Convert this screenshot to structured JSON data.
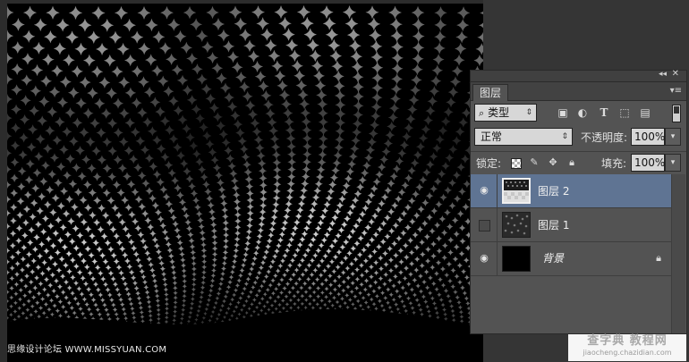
{
  "panel": {
    "tab_label": "图层",
    "filter": {
      "selected": "类型"
    },
    "filter_icons": [
      "image-icon",
      "adjustment-icon",
      "type-icon",
      "shape-icon",
      "smart-object-icon"
    ],
    "blend_mode": "正常",
    "opacity_label": "不透明度:",
    "opacity_value": "100%",
    "lock_label": "锁定:",
    "fill_label": "填充:",
    "fill_value": "100%",
    "layers": [
      {
        "name": "图层 2",
        "visible": true,
        "selected": true
      },
      {
        "name": "图层 1",
        "visible": false,
        "selected": false
      },
      {
        "name": "背景",
        "visible": true,
        "selected": false,
        "locked": true
      }
    ]
  },
  "watermark": {
    "left_text": "思缘设计论坛 WWW.MISSYUAN.COM",
    "right_text_line1": "查字典 教程网",
    "right_text_line2": "jiaocheng.chazidian.com"
  },
  "colors": {
    "panel_bg": "#535353",
    "selected_layer": "#5f7493",
    "canvas_bg": "#000000",
    "dot_color": "#ffffff"
  }
}
